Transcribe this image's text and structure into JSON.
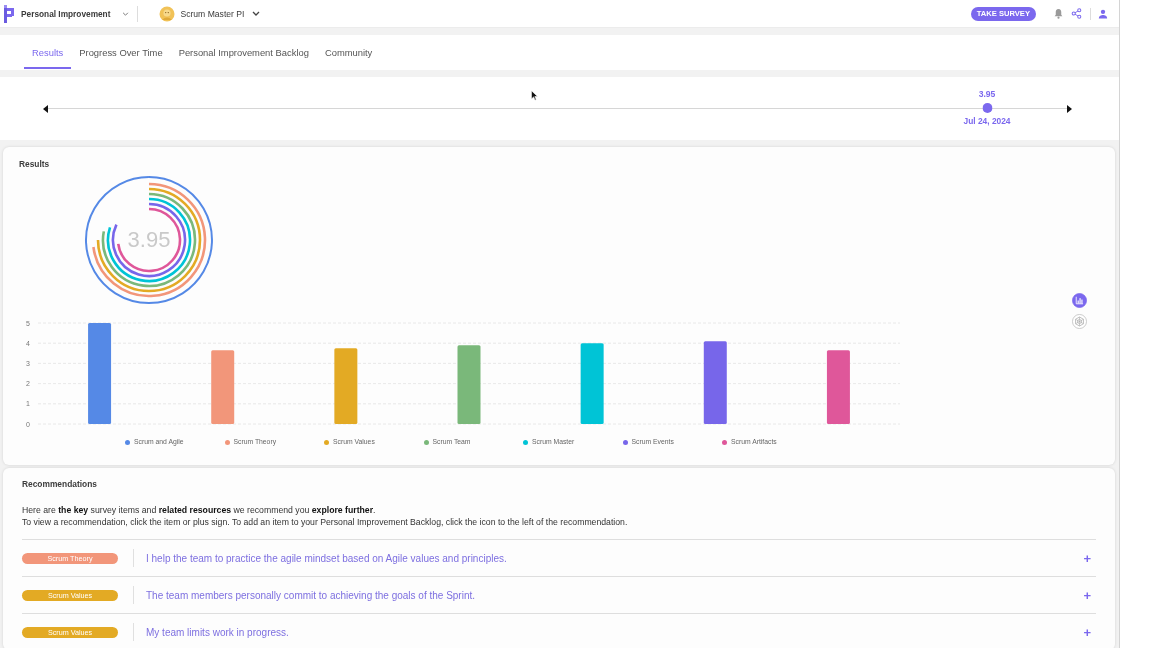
{
  "top_bar": {
    "product": "Personal Improvement",
    "assessment": "Scrum Master PI",
    "action": "TAKE SURVEY"
  },
  "tabs": [
    {
      "label": "Results",
      "selected": true
    },
    {
      "label": "Progress Over Time",
      "selected": false
    },
    {
      "label": "Personal Improvement Backlog",
      "selected": false
    },
    {
      "label": "Community",
      "selected": false
    }
  ],
  "timeline": {
    "score": "3.95",
    "date": "Jul 24, 2024"
  },
  "results": {
    "title": "Results",
    "score": "3.95",
    "chart_data": {
      "type": "bar",
      "ylim": [
        0,
        5
      ],
      "yticks": [
        0,
        1,
        2,
        3,
        4,
        5
      ],
      "grid": true,
      "series": [
        {
          "name": "Scrum and Agile",
          "color": "#5589e6",
          "values": [
            5
          ]
        },
        {
          "name": "Scrum Theory",
          "color": "#f2967a",
          "values": [
            3.65
          ]
        },
        {
          "name": "Scrum Values",
          "color": "#e3aa24",
          "values": [
            3.75
          ]
        },
        {
          "name": "Scrum Team",
          "color": "#7ab87a",
          "values": [
            3.9
          ]
        },
        {
          "name": "Scrum Master",
          "color": "#00c4d6",
          "values": [
            4
          ]
        },
        {
          "name": "Scrum Events",
          "color": "#7766ea",
          "values": [
            4.1
          ]
        },
        {
          "name": "Scrum Artifacts",
          "color": "#df579a",
          "values": [
            3.65
          ]
        }
      ]
    },
    "view_options": [
      {
        "kind": "bar",
        "selected": true
      },
      {
        "kind": "radar",
        "selected": false
      }
    ]
  },
  "recommendations": {
    "title": "Recommendations",
    "intro": "Here are **the key** survey items and **related resources** we recommend you **explore further**.",
    "instructions": "To view a recommendation, click the item or plus sign. To add an item to your Personal Improvement Backlog, click the icon to the left of the recommendation.",
    "items": [
      {
        "tag": "Scrum Theory",
        "color": "#f2967a",
        "text": "I help the team to practice the agile mindset based on Agile values and principles.",
        "expand": "+"
      },
      {
        "tag": "Scrum Values",
        "color": "#e3aa24",
        "text": "The team members personally commit to achieving the goals of the Sprint.",
        "expand": "+"
      },
      {
        "tag": "Scrum Values",
        "color": "#e3aa24",
        "text": "My team limits work in progress.",
        "expand": "+"
      }
    ]
  }
}
